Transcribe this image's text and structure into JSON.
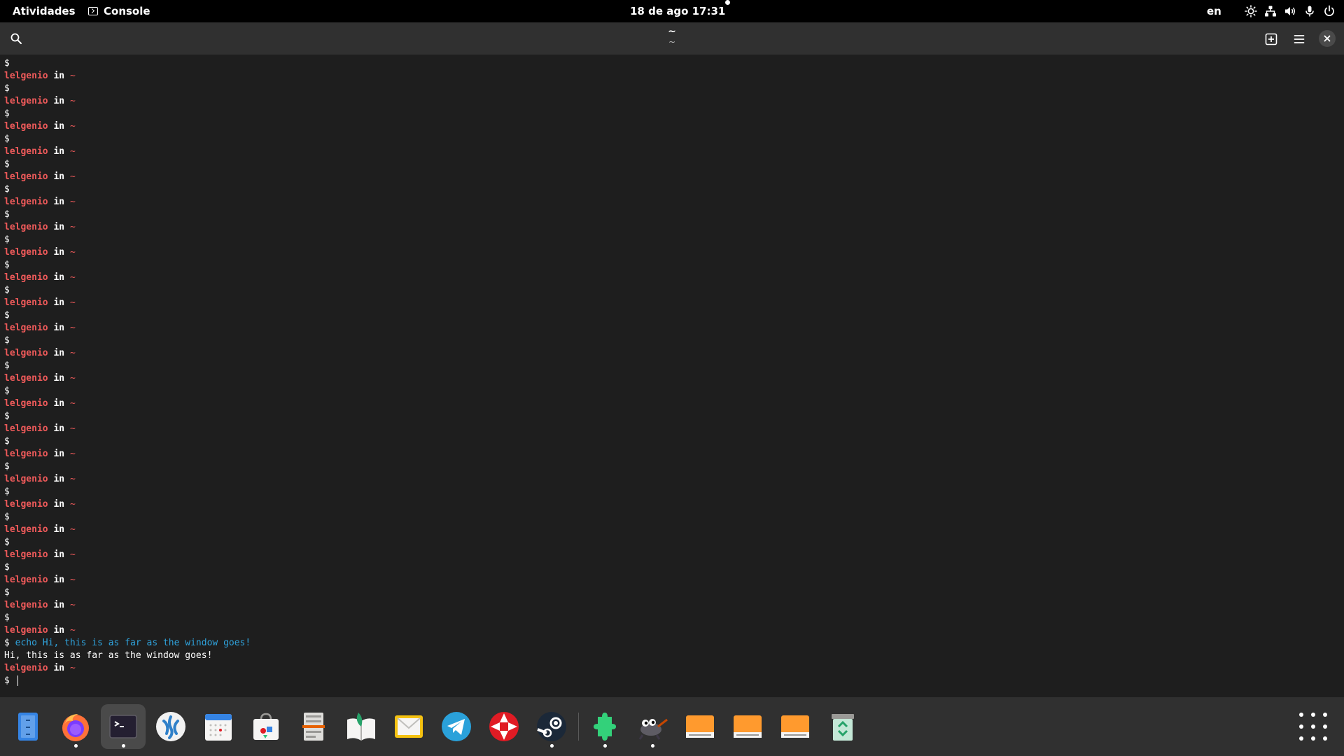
{
  "topbar": {
    "activities": "Atividades",
    "app_name": "Console",
    "datetime": "18 de ago  17:31",
    "language": "en"
  },
  "header": {
    "title": "~",
    "subtitle": "~"
  },
  "terminal": {
    "prompt_user": "lelgenio",
    "prompt_in": " in ",
    "prompt_dir": "~",
    "prompt_symbol": "$",
    "repeated_prompts": 23,
    "command": "echo Hi, this is as far as the window goes!",
    "output": "Hi, this is as far as the window goes!",
    "colors": {
      "user": "#ef5a5a",
      "command": "#2fa3dd",
      "background": "#1e1e1e"
    }
  },
  "dock": {
    "apps": [
      {
        "icon": "files-icon",
        "running": false
      },
      {
        "icon": "firefox-icon",
        "running": true
      },
      {
        "icon": "console-icon",
        "running": true,
        "active": true
      },
      {
        "icon": "vscodium-icon",
        "running": false
      },
      {
        "icon": "calendar-icon",
        "running": false
      },
      {
        "icon": "software-icon",
        "running": false
      },
      {
        "icon": "document-scanner-icon",
        "running": false
      },
      {
        "icon": "foliate-icon",
        "running": false
      },
      {
        "icon": "mail-icon",
        "running": false
      },
      {
        "icon": "telegram-icon",
        "running": false
      },
      {
        "icon": "video-player-icon",
        "running": false
      },
      {
        "icon": "steam-icon",
        "running": true
      },
      {
        "icon": "extensions-icon",
        "running": true
      },
      {
        "icon": "gimp-icon",
        "running": true
      },
      {
        "icon": "drive-icon",
        "running": false
      },
      {
        "icon": "drive-icon",
        "running": false
      },
      {
        "icon": "drive-icon",
        "running": false
      },
      {
        "icon": "trash-icon",
        "running": false
      }
    ]
  }
}
